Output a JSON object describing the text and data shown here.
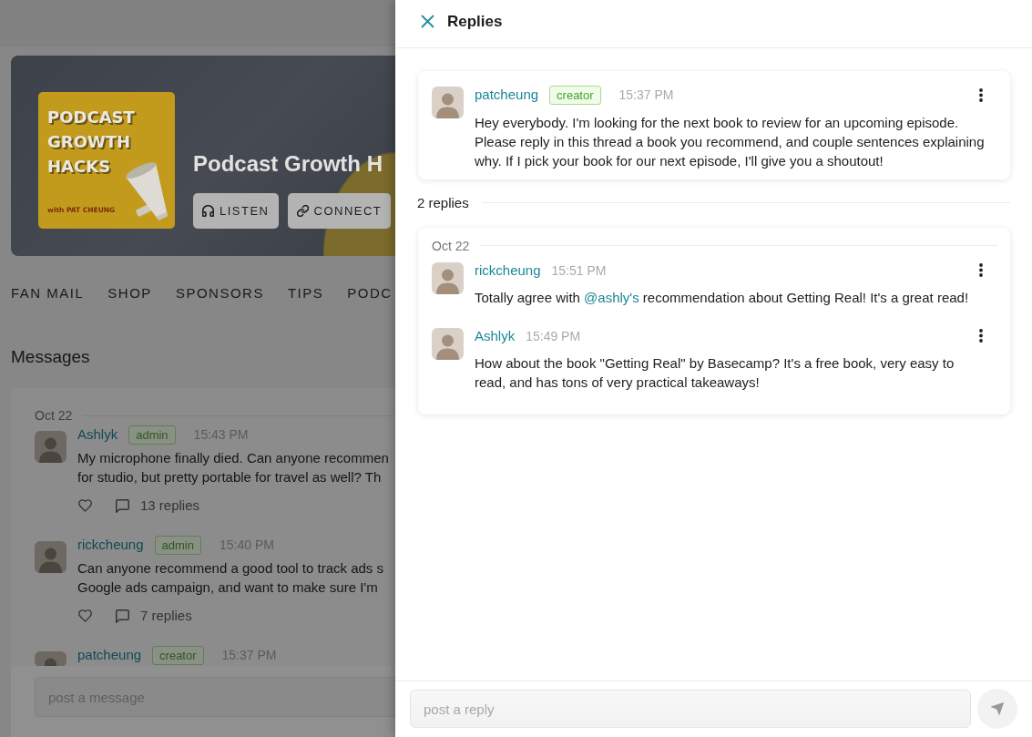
{
  "page": {
    "banner": {
      "cover_title": "PODCAST GROWTH HACKS",
      "cover_subtitle": "with PAT CHEUNG",
      "title": "Podcast Growth H",
      "buttons": [
        {
          "kind": "headphones",
          "label": "LISTEN"
        },
        {
          "kind": "link",
          "label": "CONNECT"
        }
      ]
    },
    "nav": [
      "FAN MAIL",
      "SHOP",
      "SPONSORS",
      "TIPS",
      "PODC"
    ],
    "heading": "Messages",
    "feed": {
      "date": "Oct 22",
      "messages": [
        {
          "author": "Ashlyk",
          "role": "admin",
          "time": "15:43 PM",
          "lines": [
            "My microphone finally died. Can anyone recommen",
            "for studio, but pretty portable for travel as well? Th"
          ],
          "replies": "13 replies"
        },
        {
          "author": "rickcheung",
          "role": "admin",
          "time": "15:40 PM",
          "lines": [
            "Can anyone recommend a good tool to track ads s",
            "Google ads campaign, and want to make sure I'm"
          ],
          "replies": "7 replies"
        },
        {
          "author": "patcheung",
          "role": "creator",
          "time": "15:37 PM"
        }
      ]
    },
    "composer": {
      "placeholder": "post a message"
    }
  },
  "replies_panel": {
    "title": "Replies",
    "thread": {
      "author": "patcheung",
      "role": "creator",
      "time": "15:37 PM",
      "body": [
        {
          "kind": "text",
          "text": "Hey everybody. I'm looking for the next book to review for an upcoming episode. Please reply in this thread a book you recommend, and couple sentences explaining why. If I pick your book for our next episode, I'll give you a shoutout!"
        }
      ]
    },
    "count": "2 replies",
    "date": "Oct 22",
    "replies": [
      {
        "author": "rickcheung",
        "time": "15:51 PM",
        "body": [
          {
            "kind": "text",
            "text": "Totally agree with "
          },
          {
            "kind": "mention",
            "text": "@ashly's"
          },
          {
            "kind": "text",
            "text": " recommendation about Getting Real! It's a great read!"
          }
        ]
      },
      {
        "author": "Ashlyk",
        "time": "15:49 PM",
        "body": [
          {
            "kind": "text",
            "text": "How about the book \"Getting Real\" by Basecamp? It's a free book, very easy to read, and has tons of very practical takeaways!"
          }
        ]
      }
    ],
    "composer": {
      "placeholder": "post a reply"
    }
  }
}
